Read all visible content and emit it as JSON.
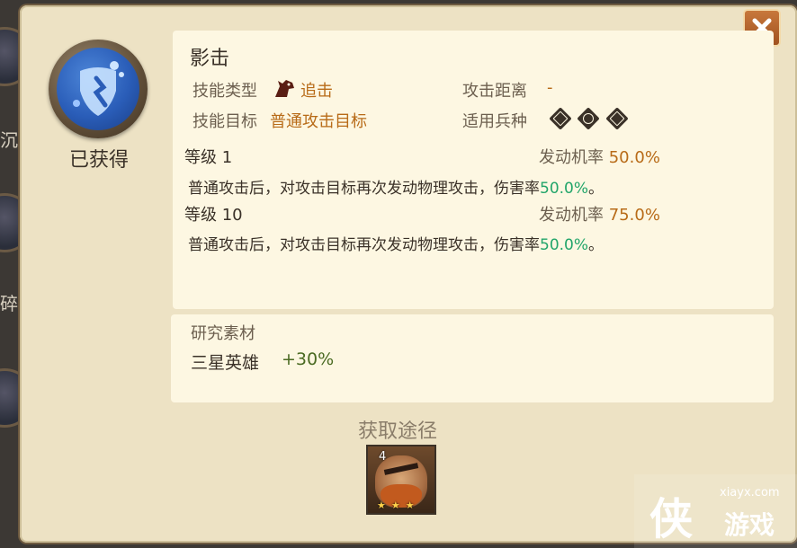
{
  "skill": {
    "status": "已获得",
    "name": "影击",
    "type_label": "技能类型",
    "type_value": "追击",
    "type_icon": "horse-head-icon",
    "range_label": "攻击距离",
    "range_value": "-",
    "target_label": "技能目标",
    "target_value": "普通攻击目标",
    "troops_label": "适用兵种",
    "troop_icons": [
      "sword-troop-icon",
      "shield-troop-icon",
      "bow-troop-icon"
    ]
  },
  "levels": [
    {
      "level_label": "等级 1",
      "rate_label": "发动机率",
      "rate_value": "50.0%",
      "desc": "普通攻击后，对攻击目标再次发动物理攻击，伤害率",
      "desc_value": "50.0%",
      "desc_end": "。"
    },
    {
      "level_label": "等级 10",
      "rate_label": "发动机率",
      "rate_value": "75.0%",
      "desc": "普通攻击后，对攻击目标再次发动物理攻击，伤害率",
      "desc_value": "50.0%",
      "desc_end": "。"
    }
  ],
  "research": {
    "title": "研究素材",
    "item_name": "三星英雄",
    "item_bonus": "+30%"
  },
  "source": {
    "title": "获取途径",
    "hero_level": "4",
    "hero_stars": 3
  },
  "background_chars": [
    "沉",
    "碎"
  ],
  "watermark": {
    "logo": "侠",
    "url": "xiayx.com",
    "name": "游戏"
  },
  "colors": {
    "panel": "#ede2c4",
    "card": "#fdf7e2",
    "accent_orange": "#b86b18",
    "accent_green": "#22a56a",
    "close_button": "#b8652c"
  }
}
